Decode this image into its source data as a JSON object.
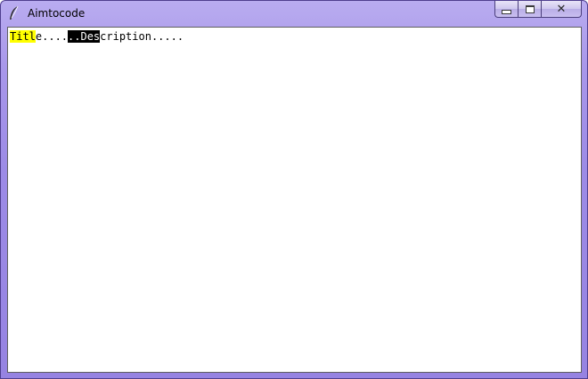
{
  "window": {
    "title": "Aimtocode",
    "icon": "feather-icon"
  },
  "controls": {
    "minimize": "minimize-icon",
    "maximize": "maximize-icon",
    "close": "close-icon"
  },
  "text_widget": {
    "seg1": "Titl",
    "seg2": "e....",
    "seg3": "..Des",
    "seg4": "cription.....",
    "highlight_colors": {
      "tag1_background": "#ffff00",
      "tag2_background": "#000000",
      "tag2_foreground": "#ffffff"
    }
  }
}
